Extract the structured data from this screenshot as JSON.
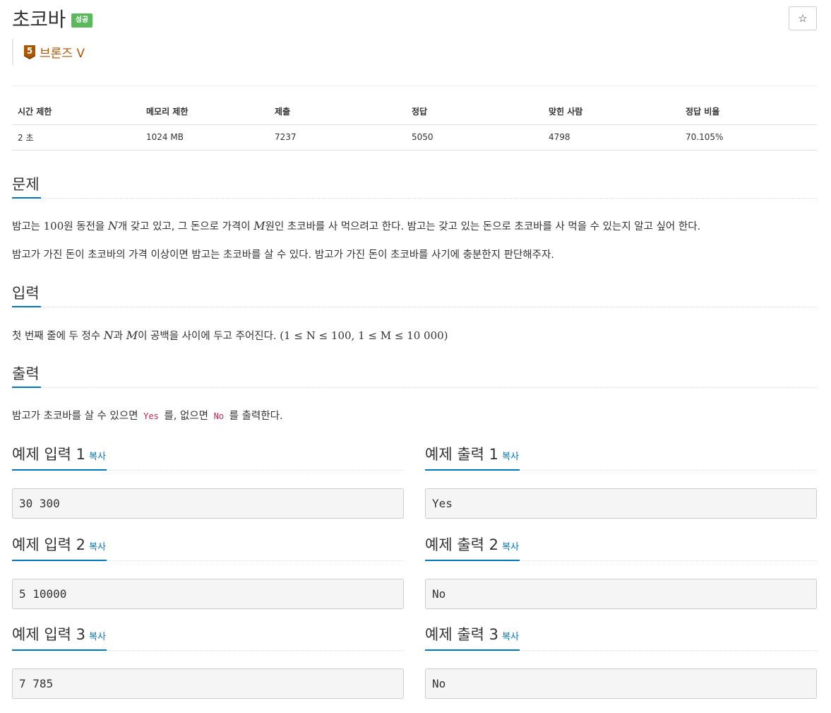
{
  "header": {
    "title": "초코바",
    "result_badge": "성공",
    "favorite_icon": "☆",
    "tier": {
      "level": "5",
      "name": "브론즈 V",
      "color": "#ad5600"
    }
  },
  "stats": {
    "headers": [
      "시간 제한",
      "메모리 제한",
      "제출",
      "정답",
      "맞힌 사람",
      "정답 비율"
    ],
    "values": [
      "2 초",
      "1024 MB",
      "7237",
      "5050",
      "4798",
      "70.105%"
    ]
  },
  "problem": {
    "title": "문제",
    "p1": {
      "a": "밤고는 ",
      "num": "100",
      "b": "원 동전을 ",
      "var1": "N",
      "c": "개 갖고 있고, 그 돈으로 가격이 ",
      "var2": "M",
      "d": "원인 초코바를 사 먹으려고 한다. 밤고는 갖고 있는 돈으로 초코바를 사 먹을 수 있는지 알고 싶어 한다."
    },
    "p2": "밤고가 가진 돈이 초코바의 가격 이상이면 밤고는 초코바를 살 수 있다. 밤고가 가진 돈이 초코바를 사기에 충분한지 판단해주자."
  },
  "input": {
    "title": "입력",
    "a": "첫 번째 줄에 두 정수 ",
    "var1": "N",
    "b": "과 ",
    "var2": "M",
    "c": "이 공백을 사이에 두고 주어진다. ",
    "constraint": "(1 ≤ N ≤ 100, 1 ≤ M ≤ 10 000)"
  },
  "output": {
    "title": "출력",
    "a": "밤고가 초코바를 살 수 있으면 ",
    "code1": "Yes",
    "b": " 를, 없으면 ",
    "code2": "No",
    "c": " 를 출력한다."
  },
  "samples": {
    "copy_label": "복사",
    "inputs": [
      {
        "title": "예제 입력 1",
        "value": "30 300"
      },
      {
        "title": "예제 입력 2",
        "value": "5 10000"
      },
      {
        "title": "예제 입력 3",
        "value": "7 785"
      }
    ],
    "outputs": [
      {
        "title": "예제 출력 1",
        "value": "Yes"
      },
      {
        "title": "예제 출력 2",
        "value": "No"
      },
      {
        "title": "예제 출력 3",
        "value": "No"
      }
    ]
  },
  "colors": {
    "accent": "#0076c0",
    "success": "#5cb85c",
    "code": "#c7254e"
  }
}
